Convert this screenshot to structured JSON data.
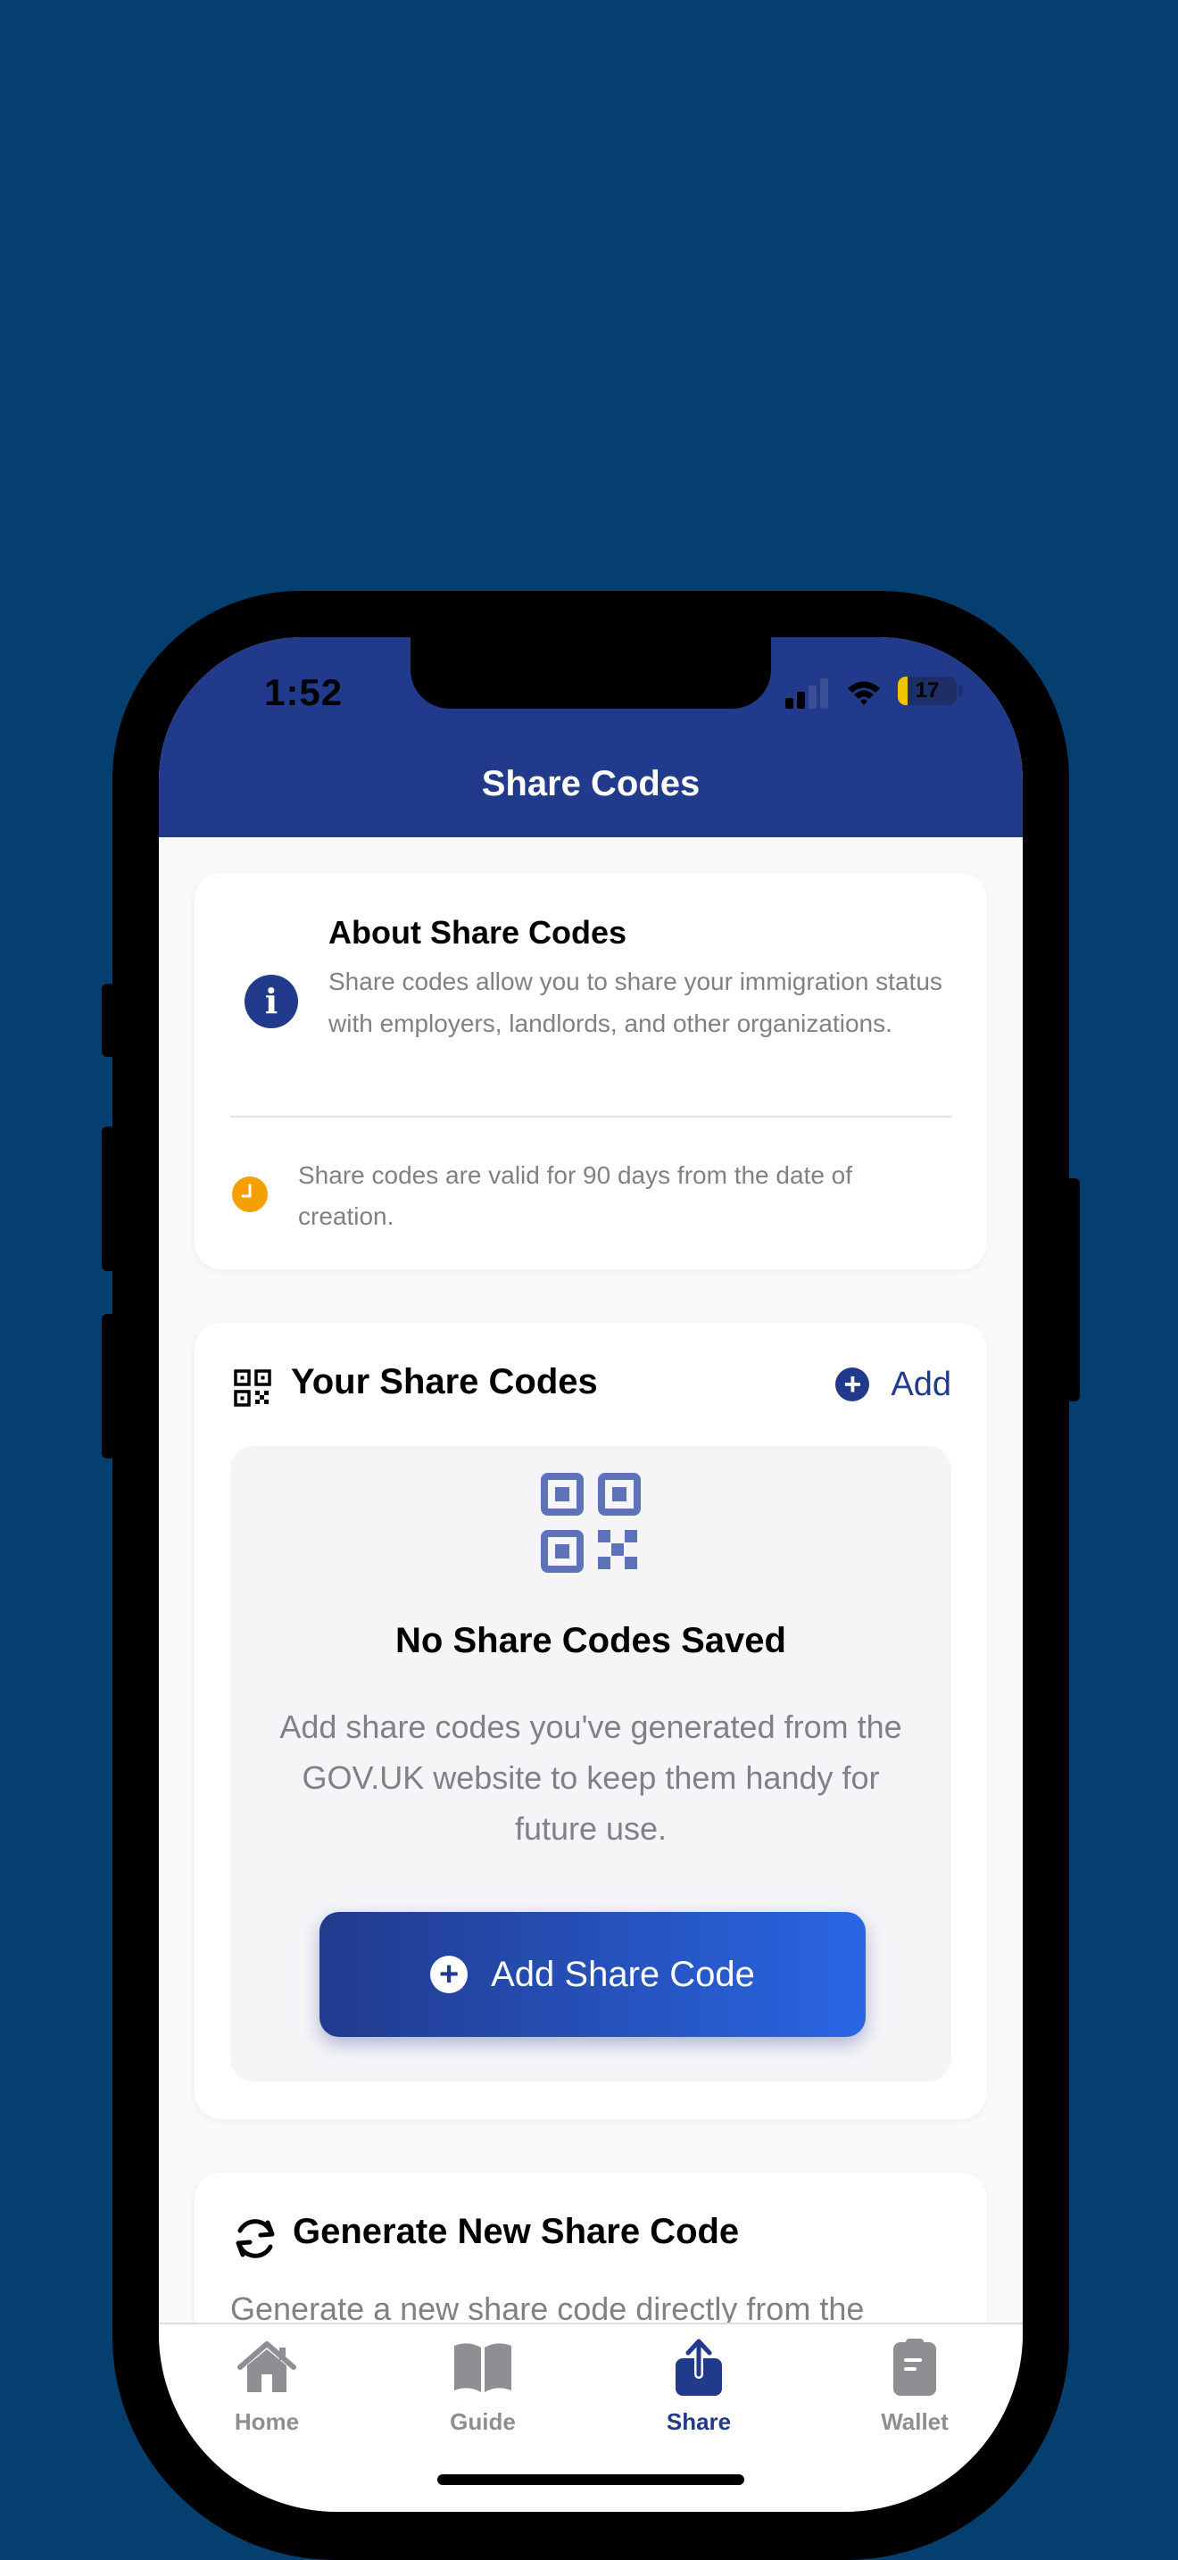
{
  "status_bar": {
    "time": "1:52",
    "battery_percent": "17",
    "battery_level": 0.17
  },
  "header": {
    "title": "Share Codes"
  },
  "about": {
    "title": "About Share Codes",
    "description": "Share codes allow you to share your immigration status with employers, landlords, and other organizations.",
    "validity_note": "Share codes are valid for 90 days from the date of creation."
  },
  "your_codes": {
    "title": "Your Share Codes",
    "add_label": "Add",
    "empty_title": "No Share Codes Saved",
    "empty_description": "Add share codes you've generated from the GOV.UK website to keep them handy for future use.",
    "add_button_label": "Add Share Code"
  },
  "generate": {
    "title": "Generate New Share Code",
    "subtitle": "Generate a new share code directly from the"
  },
  "tabs": [
    {
      "label": "Home",
      "icon": "home-icon",
      "active": false
    },
    {
      "label": "Guide",
      "icon": "book-icon",
      "active": false
    },
    {
      "label": "Share",
      "icon": "share-icon",
      "active": true
    },
    {
      "label": "Wallet",
      "icon": "wallet-icon",
      "active": false
    }
  ],
  "colors": {
    "background": "#053f6f",
    "brand": "#213a8c",
    "accent_blue": "#2a66e4",
    "warning": "#f6a000",
    "muted_text": "#808086",
    "inactive_tab": "#8e8e93"
  }
}
